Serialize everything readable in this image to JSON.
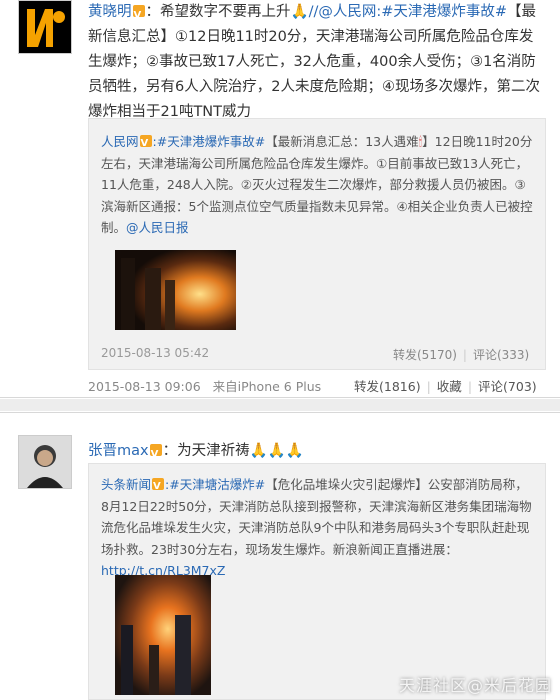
{
  "post1": {
    "author": "黄晓明",
    "text_intro": "：希望数字不要再上升",
    "mention": "//@人民网",
    "hashtag": ":#天津港爆炸事故#",
    "text_body": "【最新信息汇总】①12日晚11时20分，天津港瑞海公司所属危险品仓库发生爆炸；②事故已致17人死亡，32人危重，400余人受伤；③1名消防员牺牲，另有6人入院治疗，2人未度危险期；④现场多次爆炸，第二次爆炸相当于21吨TNT威力",
    "repost": {
      "author": "人民网",
      "hashtag": ":#天津港爆炸事故#",
      "text_a": "【最新消息汇总：13人遇难",
      "text_b": "】12日晚11时20分左右，天津港瑞海公司所属危险品仓库发生爆炸。①目前事故已致13人死亡，11人危重，248人入院。②灭火过程发生二次爆炸，部分救援人员仍被困。③滨海新区通报：5个监测点位空气质量指数未见异常。④相关企业负责人已被控制。",
      "mention": "@人民日报",
      "time": "2015-08-13 05:42",
      "forward": "转发(5170)",
      "comment": "评论(333)"
    },
    "time": "2015-08-13 09:06",
    "source": "来自iPhone 6 Plus",
    "forward": "转发(1816)",
    "collect": "收藏",
    "comment": "评论(703)"
  },
  "post2": {
    "author": "张晋max",
    "text_intro": "：为天津祈祷",
    "repost": {
      "author": "头条新闻",
      "hashtag": ":#天津塘沽爆炸#",
      "text_a": "【危化品堆垛火灾引起爆炸】公安部消防局称，8月12日22时50分，天津消防总队接到报警称，天津滨海新区港务集团瑞海物流危化品堆垛发生火灾，天津消防总队9个中队和港务局码头3个专职队赶赴现场扑救。23时30分左右，现场发生爆炸。新浪新闻正直播进展：",
      "link": "http://t.cn/RL3M7xZ"
    }
  },
  "watermark": "天涯社区@米后花园",
  "icons": [
    "verified-badge-icon",
    "praying-hands-icon",
    "candle-icon"
  ],
  "colors": {
    "link": "#2a69b4",
    "badge": "#f5a623",
    "repost_bg": "#f1f1f1"
  }
}
